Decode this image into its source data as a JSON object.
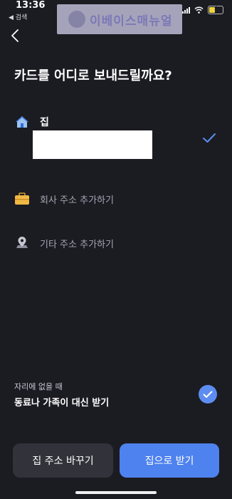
{
  "status_bar": {
    "time": "13:36",
    "back_app": "◀ 검색"
  },
  "watermark": {
    "text": "이베이스매뉴얼"
  },
  "title": "카드를 어디로 보내드릴까요?",
  "options": {
    "home": {
      "label": "집",
      "selected": true
    },
    "company": {
      "label": "회사 주소 추가하기"
    },
    "other": {
      "label": "기타 주소 추가하기"
    }
  },
  "proxy": {
    "caption": "자리에 없을 때",
    "text": "동료나 가족이 대신 받기",
    "checked": true
  },
  "buttons": {
    "change_home": "집 주소 바꾸기",
    "receive_home": "집으로 받기"
  },
  "colors": {
    "background": "#1b1b22",
    "accent": "#4e82ee",
    "check": "#5d8df0"
  }
}
